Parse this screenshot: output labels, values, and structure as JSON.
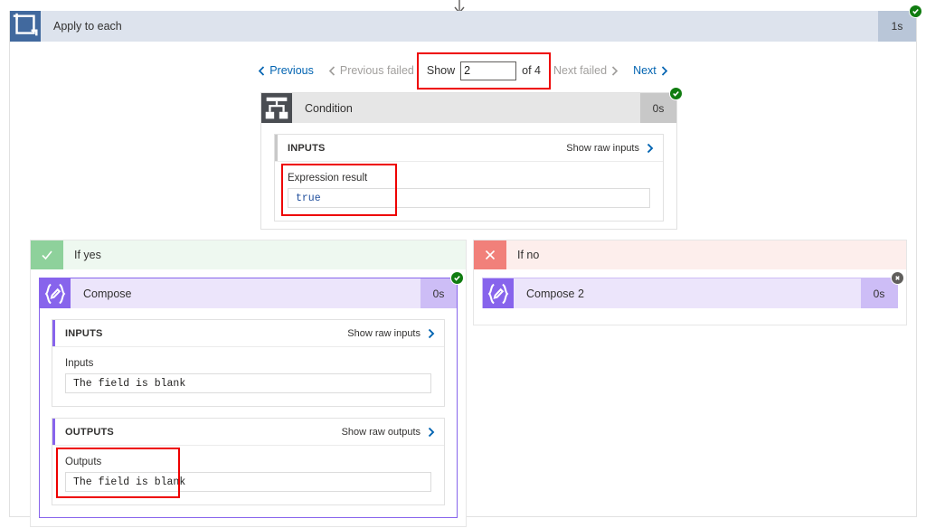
{
  "scope": {
    "title": "Apply to each",
    "duration": "1s",
    "icon": "loop-icon",
    "status": "succeeded"
  },
  "pager": {
    "previous_label": "Previous",
    "previous_failed_label": "Previous failed",
    "show_label": "Show",
    "show_value": "2",
    "of_label": "of 4",
    "next_failed_label": "Next failed",
    "next_label": "Next"
  },
  "condition": {
    "title": "Condition",
    "duration": "0s",
    "icon": "condition-icon",
    "status": "succeeded",
    "inputs": {
      "caption": "INPUTS",
      "raw_link": "Show raw inputs",
      "field_label": "Expression result",
      "field_value": "true"
    }
  },
  "branches": {
    "yes": {
      "label": "If yes",
      "icon": "checkmark-icon",
      "action": {
        "title": "Compose",
        "duration": "0s",
        "icon": "compose-icon",
        "status": "succeeded",
        "inputs": {
          "caption": "INPUTS",
          "raw_link": "Show raw inputs",
          "field_label": "Inputs",
          "field_value": "The field is blank"
        },
        "outputs": {
          "caption": "OUTPUTS",
          "raw_link": "Show raw outputs",
          "field_label": "Outputs",
          "field_value": "The field is blank"
        }
      }
    },
    "no": {
      "label": "If no",
      "icon": "cross-icon",
      "action": {
        "title": "Compose 2",
        "duration": "0s",
        "icon": "compose-icon",
        "status": "skipped"
      }
    }
  },
  "colors": {
    "accent_blue": "#0063b1",
    "scope_header": "#dde3ed",
    "scope_icon": "#41699e",
    "compose_purple": "#8764ec",
    "success_green": "#107c10",
    "skipped_gray": "#605e5c",
    "annotation_red": "#ee0000",
    "yes_green": "#8ed19b",
    "no_red": "#f1807a"
  }
}
